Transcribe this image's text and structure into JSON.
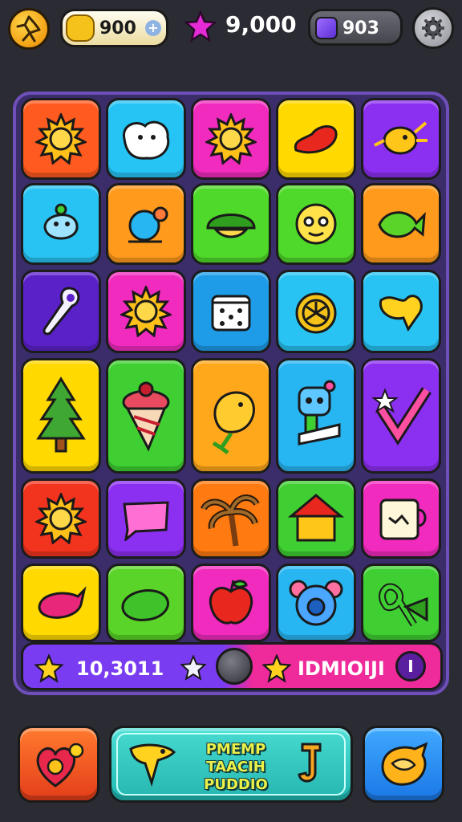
{
  "topbar": {
    "coins": "900",
    "coins_plus": "+",
    "gems": "9,000",
    "energy": "903"
  },
  "board": {
    "tiles": [
      {
        "color": "#ff5a1f",
        "icon": "sun-icon"
      },
      {
        "color": "#26c4f5",
        "icon": "fluffy-creature-icon"
      },
      {
        "color": "#f02bbd",
        "icon": "sun-icon"
      },
      {
        "color": "#ffd900",
        "icon": "jelly-bean-icon"
      },
      {
        "color": "#8b2ff0",
        "icon": "sun-creature-icon"
      },
      {
        "color": "#28c3f2",
        "icon": "whale-icon"
      },
      {
        "color": "#ff9a1c",
        "icon": "snail-icon"
      },
      {
        "color": "#4fd92a",
        "icon": "turtle-icon"
      },
      {
        "color": "#4fd92a",
        "icon": "face-icon"
      },
      {
        "color": "#ff9a1c",
        "icon": "fish-icon"
      },
      {
        "color": "#5b21c9",
        "icon": "bone-icon"
      },
      {
        "color": "#f02bbd",
        "icon": "sun-icon"
      },
      {
        "color": "#1e9ce8",
        "icon": "dice-icon"
      },
      {
        "color": "#28c3f2",
        "icon": "clock-icon"
      },
      {
        "color": "#28c3f2",
        "icon": "heart-blob-icon"
      },
      {
        "color": "#ffd900",
        "icon": "tree-icon"
      },
      {
        "color": "#3fcf32",
        "icon": "ice-cream-icon"
      },
      {
        "color": "#ffa81c",
        "icon": "bird-icon"
      },
      {
        "color": "#28b6f2",
        "icon": "robot-icon"
      },
      {
        "color": "#8b2ff0",
        "icon": "star-check-icon"
      },
      {
        "color": "#f2341f",
        "icon": "sun-icon"
      },
      {
        "color": "#8b2ff0",
        "icon": "speech-bubble-icon"
      },
      {
        "color": "#ff7a10",
        "icon": "palm-tree-icon"
      },
      {
        "color": "#3fcf32",
        "icon": "house-icon"
      },
      {
        "color": "#f02bbd",
        "icon": "cup-icon"
      },
      {
        "color": "#ffd900",
        "icon": "candy-icon"
      },
      {
        "color": "#5ad428",
        "icon": "blob-icon"
      },
      {
        "color": "#f02bbd",
        "icon": "apple-icon"
      },
      {
        "color": "#28b6f2",
        "icon": "bear-icon"
      },
      {
        "color": "#3fcf32",
        "icon": "ribbon-icon"
      }
    ]
  },
  "scorebar": {
    "score": "10,3011",
    "goal": "IDMIOIJI",
    "level": "I"
  },
  "controls": {
    "boost_label_line1": "PMEMP",
    "boost_label_line2": "TAACIH",
    "boost_label_line3": "PUDDIO"
  },
  "colors": {
    "background": "#2b2b33",
    "board_border": "#6f4fb9",
    "score_left": "#7a3cf0",
    "score_right": "#ef2a9a"
  }
}
